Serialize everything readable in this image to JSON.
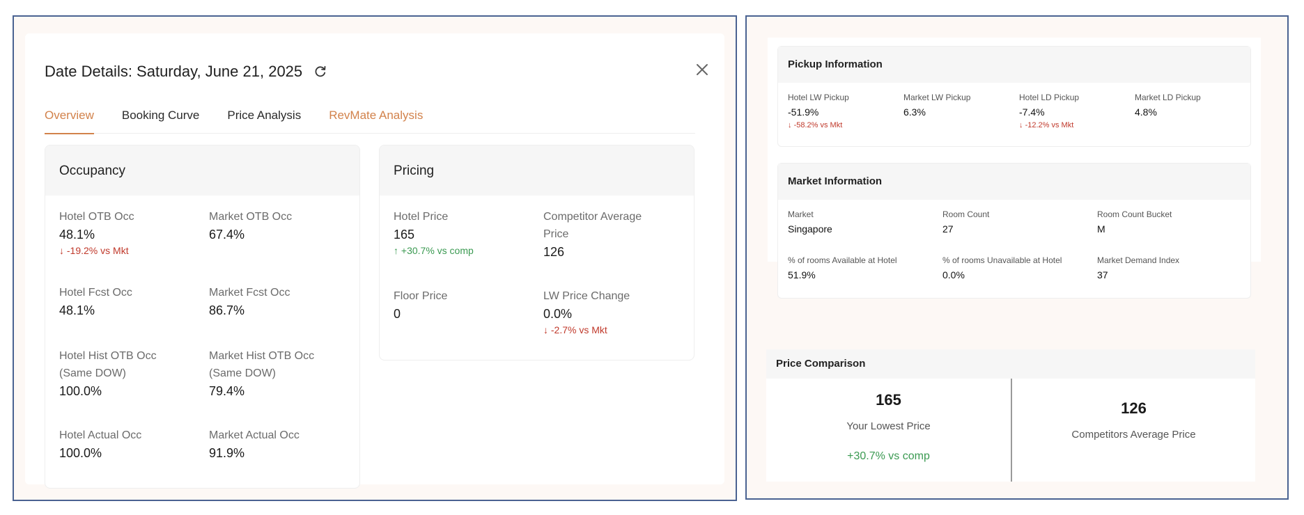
{
  "left": {
    "title": "Date Details: Saturday, June 21, 2025",
    "tabs": [
      {
        "label": "Overview"
      },
      {
        "label": "Booking Curve"
      },
      {
        "label": "Price Analysis"
      },
      {
        "label": "RevMate Analysis"
      }
    ],
    "occupancy": {
      "title": "Occupancy",
      "metrics": [
        {
          "label": "Hotel OTB Occ",
          "value": "48.1%",
          "delta": "-19.2% vs Mkt"
        },
        {
          "label": "Market OTB Occ",
          "value": "67.4%"
        },
        {
          "label": "Hotel Fcst Occ",
          "value": "48.1%"
        },
        {
          "label": "Market Fcst Occ",
          "value": "86.7%"
        },
        {
          "label": "Hotel Hist OTB Occ (Same DOW)",
          "value": "100.0%"
        },
        {
          "label": "Market Hist OTB Occ (Same DOW)",
          "value": "79.4%"
        },
        {
          "label": "Hotel Actual Occ",
          "value": "100.0%"
        },
        {
          "label": "Market Actual Occ",
          "value": "91.9%"
        }
      ]
    },
    "pricing": {
      "title": "Pricing",
      "metrics": [
        {
          "label": "Hotel Price",
          "value": "165",
          "delta": "+30.7% vs comp"
        },
        {
          "label": "Competitor Average Price",
          "value": "126"
        },
        {
          "label": "Floor Price",
          "value": "0"
        },
        {
          "label": "LW Price Change",
          "value": "0.0%",
          "delta": "-2.7% vs Mkt"
        }
      ]
    }
  },
  "right": {
    "pickup": {
      "title": "Pickup Information",
      "items": [
        {
          "label": "Hotel LW Pickup",
          "value": "-51.9%",
          "delta": "-58.2% vs Mkt"
        },
        {
          "label": "Market LW Pickup",
          "value": "6.3%"
        },
        {
          "label": "Hotel LD Pickup",
          "value": "-7.4%",
          "delta": "-12.2% vs Mkt"
        },
        {
          "label": "Market LD Pickup",
          "value": "4.8%"
        }
      ]
    },
    "market": {
      "title": "Market Information",
      "items": [
        {
          "label": "Market",
          "value": "Singapore"
        },
        {
          "label": "Room Count",
          "value": "27"
        },
        {
          "label": "Room Count Bucket",
          "value": "M"
        },
        {
          "label": "% of rooms Available at Hotel",
          "value": "51.9%"
        },
        {
          "label": "% of rooms Unavailable at Hotel",
          "value": "0.0%"
        },
        {
          "label": "Market Demand Index",
          "value": "37"
        }
      ]
    },
    "comparison": {
      "title": "Price Comparison",
      "yours": {
        "value": "165",
        "label": "Your Lowest Price",
        "delta": "+30.7% vs comp"
      },
      "competitors": {
        "value": "126",
        "label": "Competitors Average Price"
      }
    }
  },
  "colors": {
    "accent": "#d2824b",
    "negative": "#c0392b",
    "positive": "#3b9a52",
    "frame": "#4a6291"
  }
}
